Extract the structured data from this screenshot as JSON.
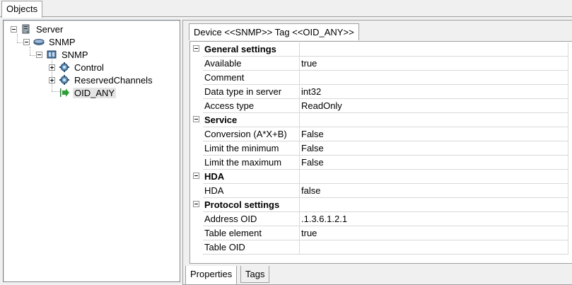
{
  "top_tab": {
    "label": "Objects"
  },
  "tree": {
    "server": "Server",
    "snmp_1": "SNMP",
    "snmp_2": "SNMP",
    "control": "Control",
    "reserved": "ReservedChannels",
    "oid_any": "OID_ANY"
  },
  "panel_title": "Device <<SNMP>> Tag <<OID_ANY>>",
  "groups": [
    {
      "name": "General settings",
      "rows": [
        {
          "name": "Available",
          "value": "true"
        },
        {
          "name": "Comment",
          "value": ""
        },
        {
          "name": "Data type in server",
          "value": "int32"
        },
        {
          "name": "Access type",
          "value": "ReadOnly"
        }
      ]
    },
    {
      "name": "Service",
      "rows": [
        {
          "name": "Conversion (A*X+B)",
          "value": "False"
        },
        {
          "name": "Limit the minimum",
          "value": "False"
        },
        {
          "name": "Limit the maximum",
          "value": "False"
        }
      ]
    },
    {
      "name": "HDA",
      "rows": [
        {
          "name": "HDA",
          "value": "false"
        }
      ]
    },
    {
      "name": "Protocol settings",
      "rows": [
        {
          "name": "Address OID",
          "value": ".1.3.6.1.2.1"
        },
        {
          "name": "Table element",
          "value": "true"
        },
        {
          "name": "Table OID",
          "value": ""
        }
      ]
    }
  ],
  "bottom_tabs": {
    "properties": "Properties",
    "tags": "Tags"
  },
  "icons": {
    "server": "server-icon",
    "device": "device-icon",
    "folder": "gear-folder-icon",
    "tag": "arrow-tag-icon"
  }
}
